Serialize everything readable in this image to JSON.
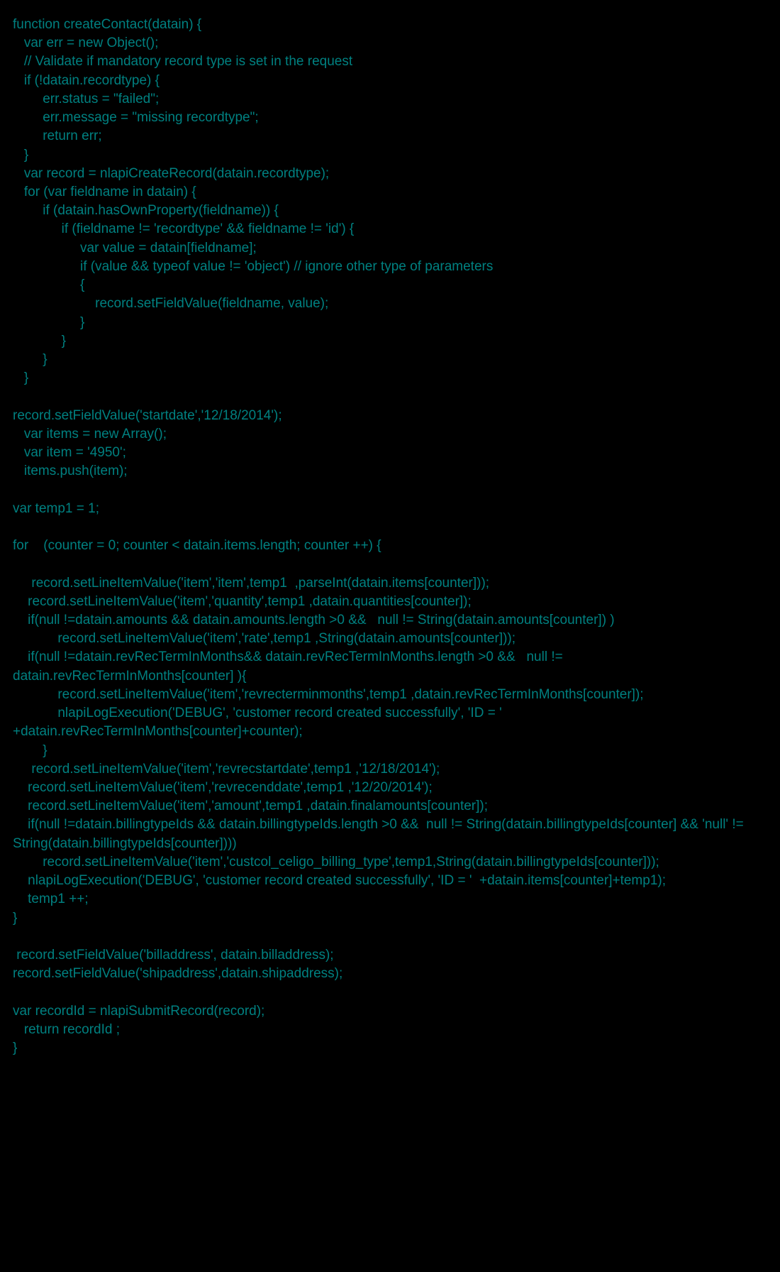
{
  "code": "function createContact(datain) {\n   var err = new Object();\n   // Validate if mandatory record type is set in the request\n   if (!datain.recordtype) {\n        err.status = \"failed\";\n        err.message = \"missing recordtype\";\n        return err;\n   }\n   var record = nlapiCreateRecord(datain.recordtype);\n   for (var fieldname in datain) {\n        if (datain.hasOwnProperty(fieldname)) {\n             if (fieldname != 'recordtype' && fieldname != 'id') {\n                  var value = datain[fieldname];\n                  if (value && typeof value != 'object') // ignore other type of parameters\n                  {\n                      record.setFieldValue(fieldname, value);\n                  }\n             }\n        }\n   }\n\nrecord.setFieldValue('startdate','12/18/2014');\n   var items = new Array();\n   var item = '4950';\n   items.push(item);\n\nvar temp1 = 1;\n\nfor    (counter = 0; counter < datain.items.length; counter ++) {\n\n     record.setLineItemValue('item','item',temp1  ,parseInt(datain.items[counter]));\n    record.setLineItemValue('item','quantity',temp1 ,datain.quantities[counter]);\n    if(null !=datain.amounts && datain.amounts.length >0 &&   null != String(datain.amounts[counter]) )\n            record.setLineItemValue('item','rate',temp1 ,String(datain.amounts[counter]));\n    if(null !=datain.revRecTermInMonths&& datain.revRecTermInMonths.length >0 &&   null != datain.revRecTermInMonths[counter] ){\n            record.setLineItemValue('item','revrecterminmonths',temp1 ,datain.revRecTermInMonths[counter]);\n            nlapiLogExecution('DEBUG', 'customer record created successfully', 'ID = '  +datain.revRecTermInMonths[counter]+counter);\n        }\n     record.setLineItemValue('item','revrecstartdate',temp1 ,'12/18/2014');\n    record.setLineItemValue('item','revrecenddate',temp1 ,'12/20/2014');\n    record.setLineItemValue('item','amount',temp1 ,datain.finalamounts[counter]);\n    if(null !=datain.billingtypeIds && datain.billingtypeIds.length >0 &&  null != String(datain.billingtypeIds[counter] && 'null' != String(datain.billingtypeIds[counter])))\n        record.setLineItemValue('item','custcol_celigo_billing_type',temp1,String(datain.billingtypeIds[counter]));\n    nlapiLogExecution('DEBUG', 'customer record created successfully', 'ID = '  +datain.items[counter]+temp1);\n    temp1 ++;\n}\n\n record.setFieldValue('billaddress', datain.billaddress);\nrecord.setFieldValue('shipaddress',datain.shipaddress);\n\nvar recordId = nlapiSubmitRecord(record);\n   return recordId ;\n}"
}
